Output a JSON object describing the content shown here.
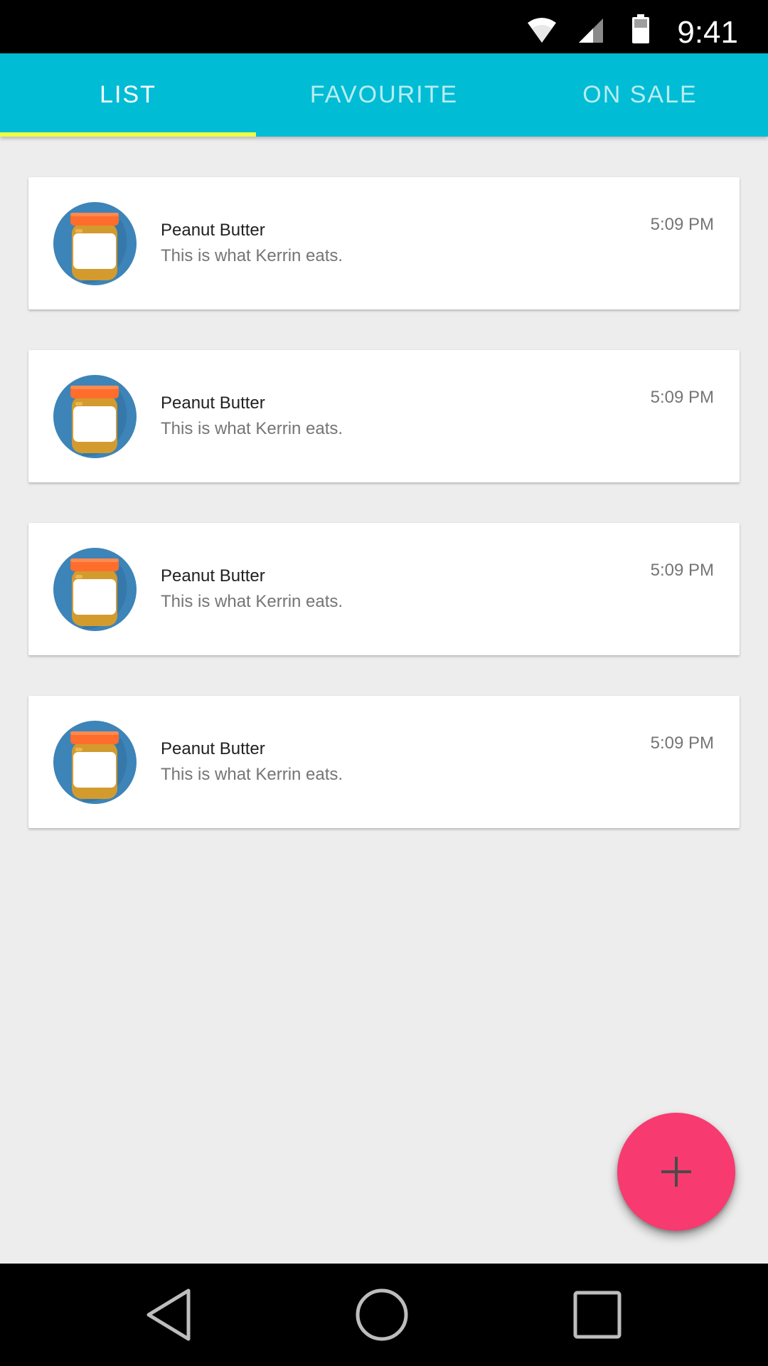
{
  "status_bar": {
    "time": "9:41",
    "icons": [
      "wifi-icon",
      "signal-icon",
      "battery-icon"
    ]
  },
  "tabs": [
    {
      "label": "LIST",
      "active": true
    },
    {
      "label": "FAVOURITE",
      "active": false
    },
    {
      "label": "ON SALE",
      "active": false
    }
  ],
  "items": [
    {
      "title": "Peanut Butter",
      "subtitle": "This is what Kerrin eats.",
      "time": "5:09 PM",
      "icon": "peanut-butter-jar-icon"
    },
    {
      "title": "Peanut Butter",
      "subtitle": "This is what Kerrin eats.",
      "time": "5:09 PM",
      "icon": "peanut-butter-jar-icon"
    },
    {
      "title": "Peanut Butter",
      "subtitle": "This is what Kerrin eats.",
      "time": "5:09 PM",
      "icon": "peanut-butter-jar-icon"
    },
    {
      "title": "Peanut Butter",
      "subtitle": "This is what Kerrin eats.",
      "time": "5:09 PM",
      "icon": "peanut-butter-jar-icon"
    }
  ],
  "fab": {
    "icon": "plus-icon"
  },
  "nav_bar": {
    "icons": [
      "back-icon",
      "home-icon",
      "recents-icon"
    ]
  },
  "colors": {
    "primary": "#00bcd4",
    "tab_indicator": "#eeff41",
    "fab": "#f73a6f",
    "background": "#ededed"
  }
}
